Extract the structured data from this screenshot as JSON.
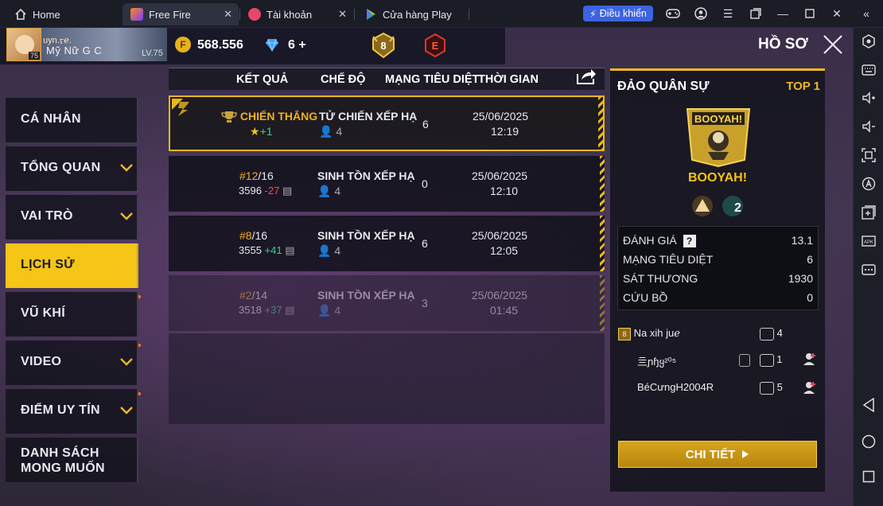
{
  "tabs": {
    "home": "Home",
    "free_fire": "Free Fire",
    "account": "Tài khoản",
    "play_store": "Cửa hàng Play"
  },
  "toolbar": {
    "control_label": "Điều khiển"
  },
  "profile": {
    "name_top": "uyn.ᡕ᠋ℯ.",
    "name": "Mỹ Nữ G C",
    "level": "LV.75",
    "avatar_level": "75",
    "gold": "568.556",
    "diamonds": "6",
    "rank_number": "8",
    "e_badge": "E"
  },
  "page_title": "HỒ SƠ",
  "menu": [
    {
      "label": "CÁ NHÂN"
    },
    {
      "label": "TỔNG QUAN"
    },
    {
      "label": "VAI TRÒ"
    },
    {
      "label": "LỊCH SỬ"
    },
    {
      "label": "VŨ KHÍ"
    },
    {
      "label": "VIDEO"
    },
    {
      "label": "ĐIỂM UY TÍN"
    },
    {
      "label_line1": "DANH SÁCH",
      "label_line2": "MONG MUỐN"
    }
  ],
  "table": {
    "headers": {
      "result": "KẾT QUẢ",
      "mode": "CHẾ ĐỘ",
      "kills": "MẠNG TIÊU DIỆT",
      "time": "THỜI GIAN"
    },
    "rows": [
      {
        "result": "CHIẾN THẮNG",
        "stars": "+1",
        "mode": "TỬ CHIẾN XẾP HẠ",
        "players": "4",
        "kills": "6",
        "date": "25/06/2025",
        "clock": "12:19"
      },
      {
        "rank": "#12",
        "total": "/16",
        "score": "3596",
        "delta": "-27",
        "mode": "SINH TỒN XẾP HẠ",
        "players": "4",
        "kills": "0",
        "date": "25/06/2025",
        "clock": "12:10"
      },
      {
        "rank": "#8",
        "total": "/16",
        "score": "3555",
        "delta": "+41",
        "mode": "SINH TỒN XẾP HẠ",
        "players": "4",
        "kills": "6",
        "date": "25/06/2025",
        "clock": "12:05"
      },
      {
        "rank": "#2",
        "total": "/14",
        "score": "3518",
        "delta": "+37",
        "mode": "SINH TỒN XẾP HẠ",
        "players": "4",
        "kills": "3",
        "date": "25/06/2025",
        "clock": "01:45"
      }
    ]
  },
  "detail": {
    "map": "ĐẢO QUÂN SỰ",
    "top": "TOP 1",
    "banner_text": "BOOYAH!",
    "result": "BOOYAH!",
    "stats": [
      {
        "label": "ĐÁNH GIÁ",
        "value": "13.1"
      },
      {
        "label": "MẠNG TIÊU DIỆT",
        "value": "6"
      },
      {
        "label": "SÁT THƯƠNG",
        "value": "1930"
      },
      {
        "label": "CỨU BỒ",
        "value": "0"
      }
    ],
    "mates": [
      {
        "name": "Na xih juℯ",
        "kills": "4"
      },
      {
        "name": "亖ɲɧყ²⁰⁵",
        "kills": "1"
      },
      {
        "name": "BéCưngH2004R",
        "kills": "5"
      }
    ],
    "button": "CHI TIẾT"
  },
  "colors": {
    "accent": "#f5c517",
    "gain": "#3ad08a",
    "loss": "#ff4b4b",
    "ctrl_blue": "#3d63e0"
  }
}
